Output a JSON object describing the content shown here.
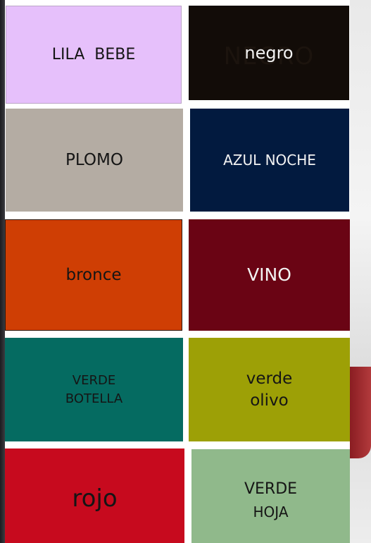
{
  "swatches": [
    {
      "id": "lila-bebe",
      "lines": [
        "LILA  BEBE"
      ],
      "color": "#e6c0fb",
      "text_color": "#151515"
    },
    {
      "id": "negro",
      "lines": [
        "negro"
      ],
      "color": "#120c08",
      "text_color": "#f3f3f3",
      "ghost_text": "NEGRO"
    },
    {
      "id": "plomo",
      "lines": [
        "PLOMO"
      ],
      "color": "#b4aca3",
      "text_color": "#151515"
    },
    {
      "id": "azul-noche",
      "lines": [
        "AZUL NOCHE"
      ],
      "color": "#021a3f",
      "text_color": "#f3f3f3"
    },
    {
      "id": "bronce",
      "lines": [
        "bronce"
      ],
      "color": "#cf3e04",
      "text_color": "#151515"
    },
    {
      "id": "vino",
      "lines": [
        "VINO"
      ],
      "color": "#6a0414",
      "text_color": "#f3f3f3"
    },
    {
      "id": "verde-botella",
      "lines": [
        "VERDE",
        "BOTELLA"
      ],
      "color": "#056b61",
      "text_color": "#151515"
    },
    {
      "id": "verde-olivo",
      "lines": [
        "verde",
        "olivo"
      ],
      "color": "#9da006",
      "text_color": "#151515"
    },
    {
      "id": "rojo",
      "lines": [
        "rojo"
      ],
      "color": "#c70a1e",
      "text_color": "#151515"
    },
    {
      "id": "verde-hoja",
      "lines": [
        "VERDE",
        "HOJA"
      ],
      "color": "#90b98b",
      "text_color": "#151515"
    }
  ]
}
